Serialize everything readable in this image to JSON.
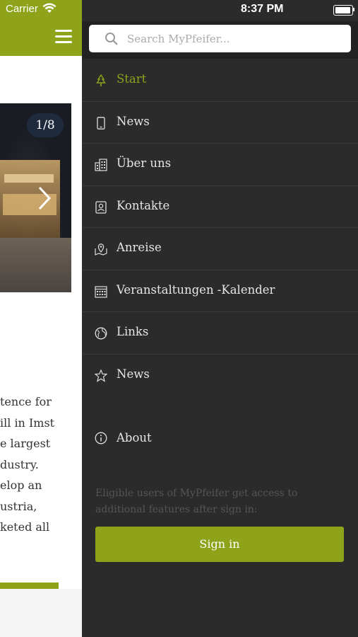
{
  "status_bar": {
    "carrier": "Carrier",
    "time": "8:37 PM"
  },
  "background": {
    "slide_counter": "1/8",
    "text_lines": [
      "tence for",
      "ill in Imst",
      "e largest",
      "dustry.",
      "elop an",
      "ustria,",
      "keted all"
    ]
  },
  "drawer": {
    "search": {
      "placeholder": "Search MyPfeifer..."
    },
    "items": [
      {
        "label": "Start",
        "icon": "tree-icon",
        "active": true
      },
      {
        "label": "News",
        "icon": "phone-icon"
      },
      {
        "label": "Über uns",
        "icon": "building-icon"
      },
      {
        "label": "Kontakte",
        "icon": "contact-card-icon"
      },
      {
        "label": "Anreise",
        "icon": "map-pin-icon"
      },
      {
        "label": "Veranstaltungen -Kalender",
        "icon": "calendar-icon"
      },
      {
        "label": "Links",
        "icon": "globe-icon"
      },
      {
        "label": "News",
        "icon": "star-icon"
      }
    ],
    "about": {
      "label": "About",
      "icon": "info-icon"
    },
    "note": "Eligible users of MyPfeifer get access to additional features after sign in:",
    "signin_label": "Sign in"
  },
  "colors": {
    "accent": "#8ea21a",
    "drawer_bg": "#2b2b2b"
  }
}
